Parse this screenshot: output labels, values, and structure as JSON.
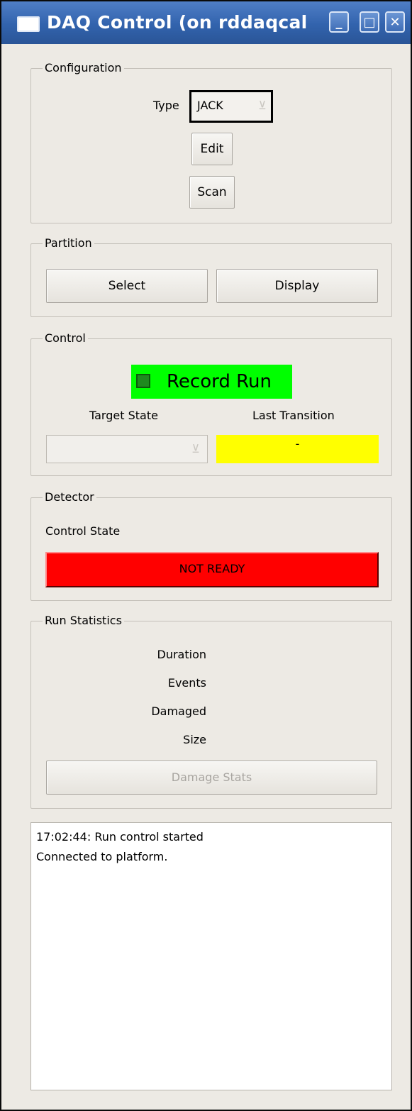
{
  "window": {
    "title": "DAQ Control (on rddaqcal",
    "minimize_glyph": "_",
    "maximize_glyph": "□",
    "close_glyph": "✕"
  },
  "configuration": {
    "group_title": "Configuration",
    "type_label": "Type",
    "type_value": "JACK",
    "edit_label": "Edit",
    "scan_label": "Scan"
  },
  "partition": {
    "group_title": "Partition",
    "select_label": "Select",
    "display_label": "Display"
  },
  "control": {
    "group_title": "Control",
    "record_run_label": "Record Run",
    "record_run_checked": false,
    "target_state_label": "Target State",
    "target_state_value": "",
    "last_transition_label": "Last Transition",
    "last_transition_value": "-"
  },
  "detector": {
    "group_title": "Detector",
    "control_state_label": "Control State",
    "control_state_value": "NOT READY"
  },
  "run_statistics": {
    "group_title": "Run Statistics",
    "duration_label": "Duration",
    "events_label": "Events",
    "damaged_label": "Damaged",
    "size_label": "Size",
    "damage_stats_label": "Damage Stats"
  },
  "log": {
    "lines": [
      "17:02:44: Run control started",
      "Connected to platform."
    ]
  },
  "colors": {
    "titlebar": "#3263ad",
    "window_bg": "#edeae4",
    "record_run_bg": "#00ff00",
    "last_transition_bg": "#ffff00",
    "not_ready_bg": "#ff0000"
  },
  "icons": {
    "window_icon": "window-icon",
    "combo_arrow": "chevron-down-icon"
  }
}
